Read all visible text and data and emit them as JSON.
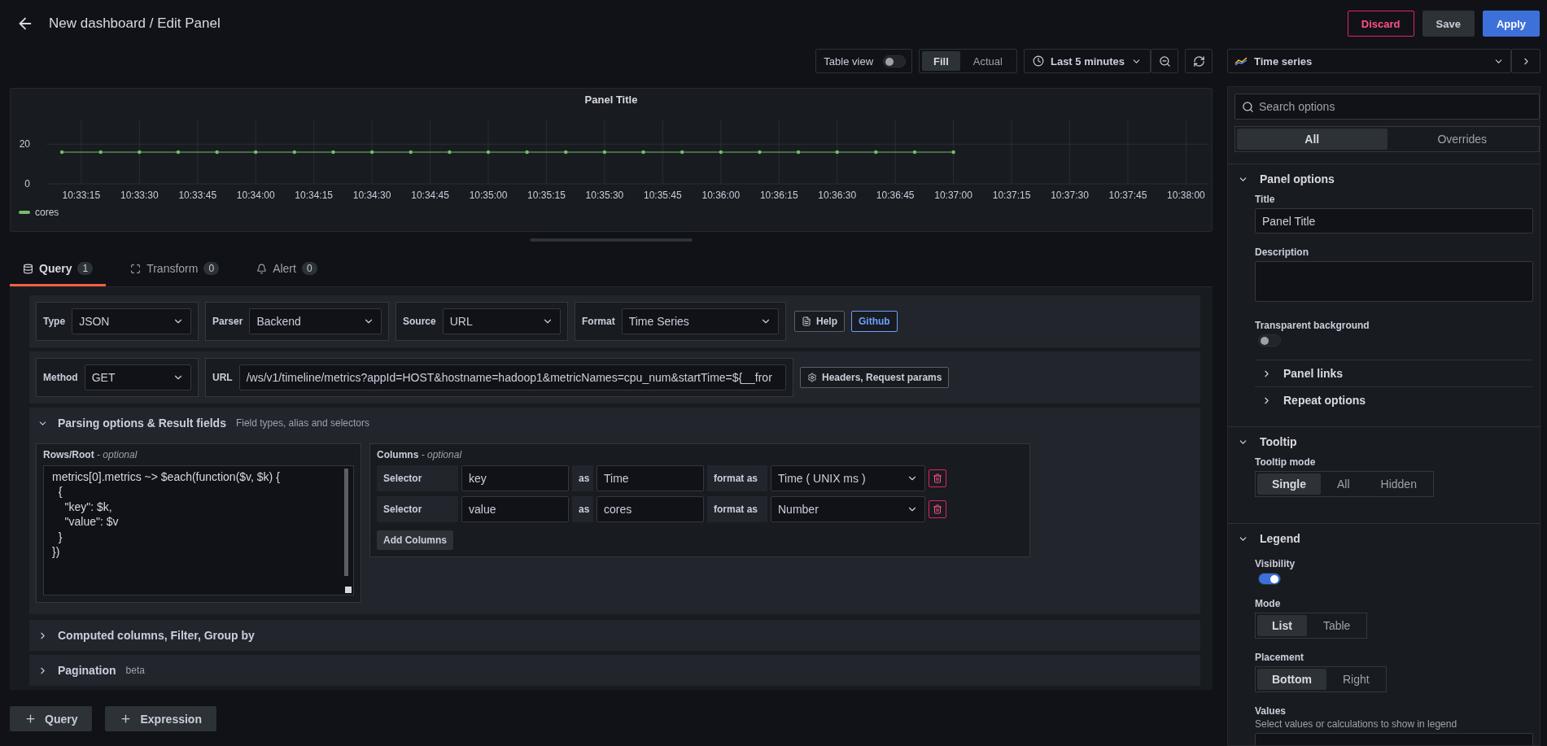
{
  "header": {
    "title": "New dashboard / Edit Panel",
    "buttons": [
      {
        "label": "Discard",
        "kind": "danger"
      },
      {
        "label": "Save",
        "kind": "secondary"
      },
      {
        "label": "Apply",
        "kind": "primary"
      }
    ]
  },
  "toolbar": {
    "table_view": {
      "label": "Table view",
      "on": false
    },
    "size_modes": [
      {
        "label": "Fill",
        "selected": true
      },
      {
        "label": "Actual",
        "selected": false
      }
    ],
    "time_range": "Last 5 minutes"
  },
  "visualization": {
    "label": "Time series"
  },
  "panel": {
    "title": "Panel Title",
    "chart_data": {
      "type": "line",
      "categories": [
        null,
        "10:33:15",
        null,
        null,
        "10:33:30",
        null,
        null,
        "10:33:45",
        null,
        null,
        "10:34:00",
        null,
        null,
        "10:34:15",
        null,
        null,
        "10:34:30",
        null,
        null,
        "10:34:45",
        null,
        null,
        "10:35:00",
        null,
        null,
        "10:35:15",
        null,
        null,
        "10:35:30",
        null,
        null,
        "10:35:45",
        null,
        null,
        "10:36:00",
        null,
        null,
        "10:36:15",
        null,
        null,
        "10:36:30",
        null,
        null,
        "10:36:45",
        null,
        null,
        "10:37:00",
        null,
        null,
        "10:37:15",
        null,
        null,
        "10:37:30",
        null,
        null,
        "10:37:45",
        null,
        null,
        "10:38:00"
      ],
      "series": [
        {
          "name": "cores",
          "color": "#73bf69",
          "values": [
            16,
            null,
            16,
            null,
            16,
            null,
            16,
            null,
            16,
            null,
            16,
            null,
            16,
            null,
            16,
            null,
            16,
            null,
            16,
            null,
            16,
            null,
            16,
            null,
            16,
            null,
            16,
            null,
            16,
            null,
            16,
            null,
            16,
            null,
            16,
            null,
            16,
            null,
            16,
            null,
            16,
            null,
            16,
            null,
            16,
            null,
            16,
            null,
            null,
            null,
            null,
            null,
            null,
            null,
            null,
            null,
            null,
            null,
            null
          ]
        }
      ],
      "ylim": [
        0,
        32
      ],
      "yticks": [
        0,
        20
      ],
      "grid": true
    }
  },
  "query_tabs": [
    {
      "label": "Query",
      "count": "1",
      "kind": "query",
      "selected": true
    },
    {
      "label": "Transform",
      "count": "0",
      "kind": "transform",
      "selected": false
    },
    {
      "label": "Alert",
      "count": "0",
      "kind": "alert",
      "selected": false
    }
  ],
  "query": {
    "source_fields": [
      {
        "label": "Type",
        "value": "JSON"
      },
      {
        "label": "Parser",
        "value": "Backend"
      },
      {
        "label": "Source",
        "value": "URL"
      },
      {
        "label": "Format",
        "value": "Time Series"
      }
    ],
    "help_button": "Help",
    "github_link": "Github",
    "method": {
      "label": "Method",
      "value": "GET"
    },
    "url": {
      "label": "URL",
      "value": "/ws/v1/timeline/metrics?appId=HOST&hostname=hadoop1&metricNames=cpu_num&startTime=${__fror"
    },
    "headers_button": "Headers, Request params",
    "parsing": {
      "title": "Parsing options & Result fields",
      "hint": "Field types, alias and selectors",
      "expanded": true,
      "rows_root": {
        "label": "Rows/Root",
        "optional": "- optional",
        "code": "metrics[0].metrics ~> $each(function($v, $k) {\n  {\n    \"key\": $k,\n    \"value\": $v\n  }\n})"
      },
      "columns": {
        "label": "Columns",
        "optional": "- optional",
        "add_button": "Add Columns",
        "rows": [
          {
            "selector_label": "Selector",
            "selector": "key",
            "as_label": "as",
            "alias": "Time",
            "format_label": "format as",
            "format": "Time ( UNIX ms )"
          },
          {
            "selector_label": "Selector",
            "selector": "value",
            "as_label": "as",
            "alias": "cores",
            "format_label": "format as",
            "format": "Number"
          }
        ]
      }
    },
    "sections": [
      {
        "title": "Computed columns, Filter, Group by",
        "expanded": false
      },
      {
        "title": "Pagination",
        "hint": "beta",
        "expanded": false
      }
    ]
  },
  "add_buttons": [
    "Query",
    "Expression"
  ],
  "options": {
    "search": {
      "placeholder": "Search options"
    },
    "tabs": [
      {
        "label": "All",
        "selected": true
      },
      {
        "label": "Overrides",
        "selected": false
      }
    ],
    "sections": [
      {
        "title": "Panel options",
        "expanded": true,
        "items": [
          {
            "kind": "text",
            "label": "Title",
            "value": "Panel Title"
          },
          {
            "kind": "textarea",
            "label": "Description"
          },
          {
            "kind": "switch",
            "label": "Transparent background",
            "on": false
          },
          {
            "kind": "subsection",
            "label": "Panel links",
            "expanded": false
          },
          {
            "kind": "subsection",
            "label": "Repeat options",
            "expanded": false
          }
        ]
      },
      {
        "title": "Tooltip",
        "expanded": true,
        "items": [
          {
            "kind": "radio",
            "label": "Tooltip mode",
            "options": [
              {
                "label": "Single",
                "selected": true
              },
              {
                "label": "All",
                "selected": false
              },
              {
                "label": "Hidden",
                "selected": false
              }
            ]
          }
        ]
      },
      {
        "title": "Legend",
        "expanded": true,
        "items": [
          {
            "kind": "switch",
            "label": "Visibility",
            "on": true
          },
          {
            "kind": "radio",
            "label": "Mode",
            "options": [
              {
                "label": "List",
                "selected": true
              },
              {
                "label": "Table",
                "selected": false
              }
            ]
          },
          {
            "kind": "radio",
            "label": "Placement",
            "options": [
              {
                "label": "Bottom",
                "selected": true
              },
              {
                "label": "Right",
                "selected": false
              }
            ]
          },
          {
            "kind": "multiselect",
            "label": "Values",
            "description": "Select values or calculations to show in legend"
          }
        ]
      }
    ]
  }
}
